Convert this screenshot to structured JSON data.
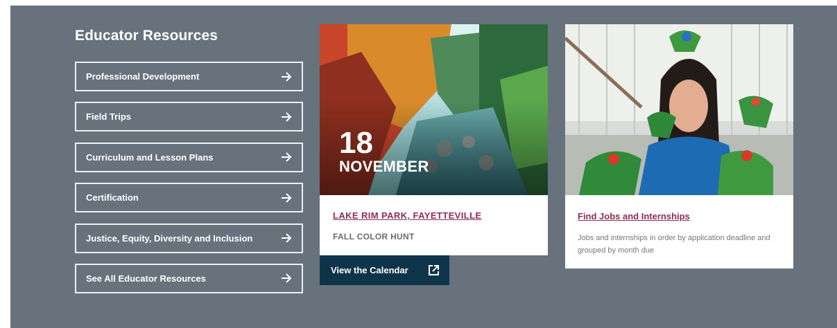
{
  "section": {
    "heading": "Educator Resources"
  },
  "resources": [
    {
      "label": "Professional Development"
    },
    {
      "label": "Field Trips"
    },
    {
      "label": "Curriculum and Lesson Plans"
    },
    {
      "label": "Certification"
    },
    {
      "label": "Justice, Equity, Diversity and Inclusion"
    },
    {
      "label": "See All Educator Resources"
    }
  ],
  "event": {
    "day": "18",
    "month": "NOVEMBER",
    "location": "LAKE RIM PARK, FAYETTEVILLE",
    "title": "FALL COLOR HUNT"
  },
  "calendar": {
    "label": "View the Calendar"
  },
  "jobs": {
    "title": "Find Jobs and Internships",
    "description": "Jobs and internships in order by application deadline and grouped by month due"
  },
  "colors": {
    "panel": "#67727d",
    "link": "#8b2d55",
    "calendar_button": "#0e3449"
  }
}
